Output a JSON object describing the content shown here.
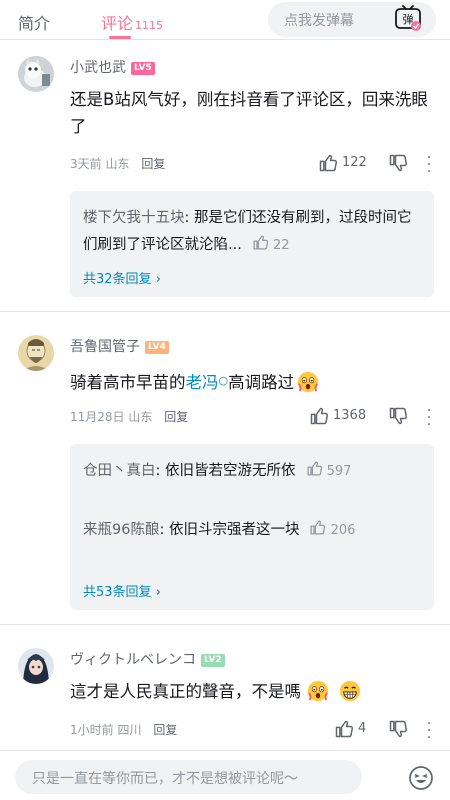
{
  "tabs": {
    "intro": "简介",
    "comments": "评论",
    "comment_count": "1115"
  },
  "danmu": {
    "placeholder": "点我发弹幕",
    "button_label": "弹"
  },
  "comments": [
    {
      "username": "小武也武",
      "level": "LV5",
      "level_color": "#ff6699",
      "text": "还是B站风气好，刚在抖音看了评论区，回来洗眼了",
      "time": "3天前",
      "location": "山东",
      "reply_label": "回复",
      "likes": "122",
      "replies": [
        {
          "name": "楼下欠我十五块",
          "text": "那是它们还没有刷到，过段时间它们刷到了评论区就沦陷...",
          "likes": "22"
        }
      ],
      "more_replies": "共32条回复"
    },
    {
      "username": "吾鲁国管子",
      "level": "LV4",
      "level_color": "#ffb37c",
      "text_before": "骑着高市早苗的",
      "text_link": "老冯",
      "text_after": "高调路过",
      "time": "11月28日",
      "location": "山东",
      "reply_label": "回复",
      "likes": "1368",
      "replies": [
        {
          "name": "仓田丶真白",
          "text": "依旧皆若空游无所依",
          "likes": "597"
        },
        {
          "name": "来瓶96陈酿",
          "text": "依旧斗宗强者这一块",
          "likes": "206"
        }
      ],
      "more_replies": "共53条回复"
    },
    {
      "username": "ヴィクトルベレンコ",
      "level": "LV2",
      "level_color": "#95ddb2",
      "text": "這才是人民真正的聲音，不是嗎",
      "time": "1小时前",
      "location": "四川",
      "reply_label": "回复",
      "likes": "4"
    }
  ],
  "bottom": {
    "placeholder": "只是一直在等你而已，才不是想被评论呢～"
  },
  "colors": {
    "accent": "#fb7299",
    "link": "#008ac5"
  }
}
